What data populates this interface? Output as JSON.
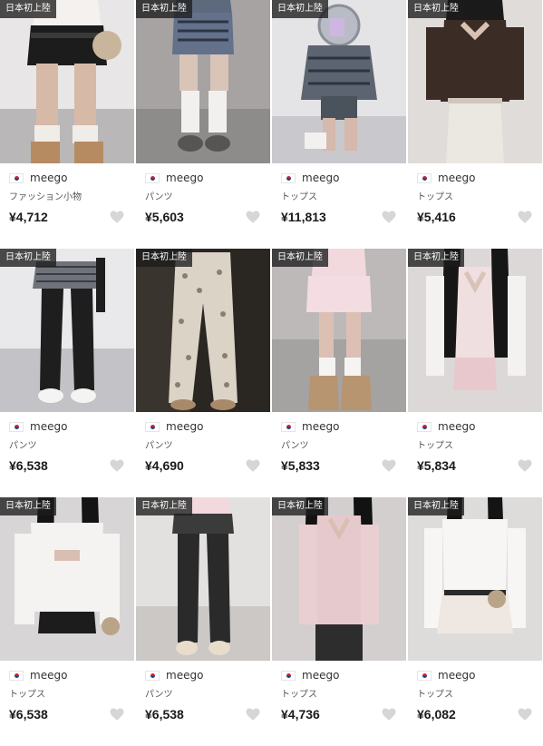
{
  "products": [
    {
      "badge": "日本初上陸",
      "seller": "meego",
      "category": "ファッション小物",
      "price": "¥4,712",
      "scene": "furshorts"
    },
    {
      "badge": "日本初上陸",
      "seller": "meego",
      "category": "パンツ",
      "price": "¥5,603",
      "scene": "navyshorts"
    },
    {
      "badge": "日本初上陸",
      "seller": "meego",
      "category": "トップス",
      "price": "¥11,813",
      "scene": "kneel"
    },
    {
      "badge": "日本初上陸",
      "seller": "meego",
      "category": "トップス",
      "price": "¥5,416",
      "scene": "browntop"
    },
    {
      "badge": "日本初上陸",
      "seller": "meego",
      "category": "パンツ",
      "price": "¥6,538",
      "scene": "flarepants"
    },
    {
      "badge": "日本初上陸",
      "seller": "meego",
      "category": "パンツ",
      "price": "¥4,690",
      "scene": "printpants"
    },
    {
      "badge": "日本初上陸",
      "seller": "meego",
      "category": "パンツ",
      "price": "¥5,833",
      "scene": "pinkshorts"
    },
    {
      "badge": "日本初上陸",
      "seller": "meego",
      "category": "トップス",
      "price": "¥5,834",
      "scene": "pinktop"
    },
    {
      "badge": "日本初上陸",
      "seller": "meego",
      "category": "トップス",
      "price": "¥6,538",
      "scene": "whitetop"
    },
    {
      "badge": "日本初上陸",
      "seller": "meego",
      "category": "パンツ",
      "price": "¥6,538",
      "scene": "blackflare"
    },
    {
      "badge": "日本初上陸",
      "seller": "meego",
      "category": "トップス",
      "price": "¥4,736",
      "scene": "pinklace"
    },
    {
      "badge": "日本初上陸",
      "seller": "meego",
      "category": "トップス",
      "price": "¥6,082",
      "scene": "whitewrap"
    }
  ],
  "colors": {
    "badge_bg": "#1c1c1c",
    "heart": "#d6d6d6",
    "price": "#1a1a1a"
  },
  "icons": {
    "flag": "korea-flag-icon",
    "heart": "heart-icon"
  }
}
